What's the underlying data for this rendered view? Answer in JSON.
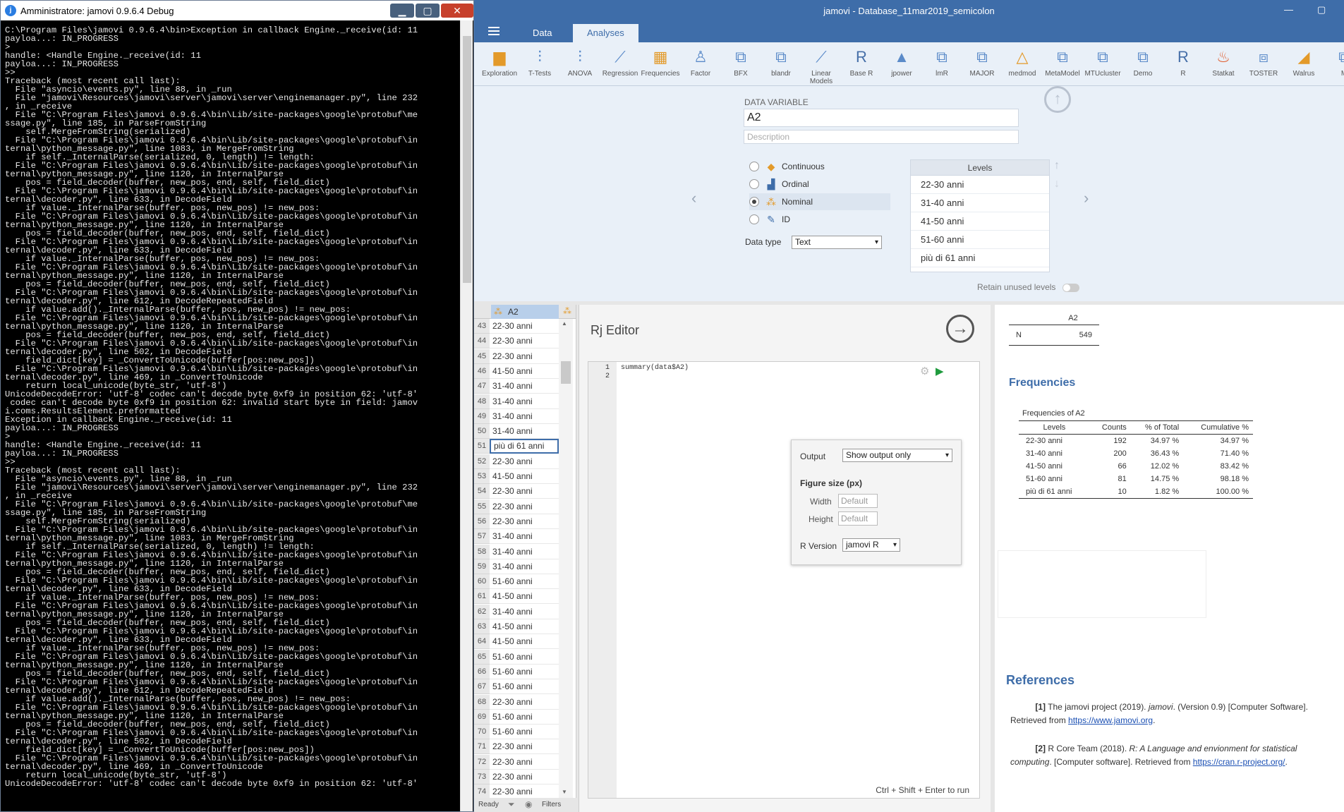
{
  "console": {
    "title": "Amministratore: jamovi 0.9.6.4 Debug",
    "icon": "jamovi-icon",
    "lines": [
      "C:\\Program Files\\jamovi 0.9.6.4\\bin>Exception in callback Engine._receive(id: 11",
      "",
      "payloa...: IN_PROGRESS",
      ">",
      "handle: <Handle Engine._receive(id: 11",
      "payloa...: IN_PROGRESS",
      ">>",
      "Traceback (most recent call last):",
      "  File \"asyncio\\events.py\", line 88, in _run",
      "  File \"jamovi\\Resources\\jamovi\\server\\jamovi\\server\\enginemanager.py\", line 232",
      ", in _receive",
      "  File \"C:\\Program Files\\jamovi 0.9.6.4\\bin\\Lib/site-packages\\google\\protobuf\\me",
      "ssage.py\", line 185, in ParseFromString",
      "    self.MergeFromString(serialized)",
      "  File \"C:\\Program Files\\jamovi 0.9.6.4\\bin\\Lib/site-packages\\google\\protobuf\\in",
      "ternal\\python_message.py\", line 1083, in MergeFromString",
      "    if self._InternalParse(serialized, 0, length) != length:",
      "  File \"C:\\Program Files\\jamovi 0.9.6.4\\bin\\Lib/site-packages\\google\\protobuf\\in",
      "ternal\\python_message.py\", line 1120, in InternalParse",
      "    pos = field_decoder(buffer, new_pos, end, self, field_dict)",
      "  File \"C:\\Program Files\\jamovi 0.9.6.4\\bin\\Lib/site-packages\\google\\protobuf\\in",
      "ternal\\decoder.py\", line 633, in DecodeField",
      "    if value._InternalParse(buffer, pos, new_pos) != new_pos:",
      "  File \"C:\\Program Files\\jamovi 0.9.6.4\\bin\\Lib/site-packages\\google\\protobuf\\in",
      "ternal\\python_message.py\", line 1120, in InternalParse",
      "    pos = field_decoder(buffer, new_pos, end, self, field_dict)",
      "  File \"C:\\Program Files\\jamovi 0.9.6.4\\bin\\Lib/site-packages\\google\\protobuf\\in",
      "ternal\\decoder.py\", line 633, in DecodeField",
      "    if value._InternalParse(buffer, pos, new_pos) != new_pos:",
      "  File \"C:\\Program Files\\jamovi 0.9.6.4\\bin\\Lib/site-packages\\google\\protobuf\\in",
      "ternal\\python_message.py\", line 1120, in InternalParse",
      "    pos = field_decoder(buffer, new_pos, end, self, field_dict)",
      "  File \"C:\\Program Files\\jamovi 0.9.6.4\\bin\\Lib/site-packages\\google\\protobuf\\in",
      "ternal\\decoder.py\", line 612, in DecodeRepeatedField",
      "    if value.add()._InternalParse(buffer, pos, new_pos) != new_pos:",
      "  File \"C:\\Program Files\\jamovi 0.9.6.4\\bin\\Lib/site-packages\\google\\protobuf\\in",
      "ternal\\python_message.py\", line 1120, in InternalParse",
      "    pos = field_decoder(buffer, new_pos, end, self, field_dict)",
      "  File \"C:\\Program Files\\jamovi 0.9.6.4\\bin\\Lib/site-packages\\google\\protobuf\\in",
      "ternal\\decoder.py\", line 502, in DecodeField",
      "    field_dict[key] = _ConvertToUnicode(buffer[pos:new_pos])",
      "  File \"C:\\Program Files\\jamovi 0.9.6.4\\bin\\Lib/site-packages\\google\\protobuf\\in",
      "ternal\\decoder.py\", line 469, in _ConvertToUnicode",
      "    return local_unicode(byte_str, 'utf-8')",
      "UnicodeDecodeError: 'utf-8' codec can't decode byte 0xf9 in position 62: 'utf-8'",
      " codec can't decode byte 0xf9 in position 62: invalid start byte in field: jamov",
      "i.coms.ResultsElement.preformatted",
      "",
      "Exception in callback Engine._receive(id: 11",
      "payloa...: IN_PROGRESS",
      ">",
      "handle: <Handle Engine._receive(id: 11",
      "payloa...: IN_PROGRESS",
      ">>",
      "Traceback (most recent call last):",
      "  File \"asyncio\\events.py\", line 88, in _run",
      "  File \"jamovi\\Resources\\jamovi\\server\\jamovi\\server\\enginemanager.py\", line 232",
      ", in _receive",
      "  File \"C:\\Program Files\\jamovi 0.9.6.4\\bin\\Lib/site-packages\\google\\protobuf\\me",
      "ssage.py\", line 185, in ParseFromString",
      "    self.MergeFromString(serialized)",
      "  File \"C:\\Program Files\\jamovi 0.9.6.4\\bin\\Lib/site-packages\\google\\protobuf\\in",
      "ternal\\python_message.py\", line 1083, in MergeFromString",
      "    if self._InternalParse(serialized, 0, length) != length:",
      "  File \"C:\\Program Files\\jamovi 0.9.6.4\\bin\\Lib/site-packages\\google\\protobuf\\in",
      "ternal\\python_message.py\", line 1120, in InternalParse",
      "    pos = field_decoder(buffer, new_pos, end, self, field_dict)",
      "  File \"C:\\Program Files\\jamovi 0.9.6.4\\bin\\Lib/site-packages\\google\\protobuf\\in",
      "ternal\\decoder.py\", line 633, in DecodeField",
      "    if value._InternalParse(buffer, pos, new_pos) != new_pos:",
      "  File \"C:\\Program Files\\jamovi 0.9.6.4\\bin\\Lib/site-packages\\google\\protobuf\\in",
      "ternal\\python_message.py\", line 1120, in InternalParse",
      "    pos = field_decoder(buffer, new_pos, end, self, field_dict)",
      "  File \"C:\\Program Files\\jamovi 0.9.6.4\\bin\\Lib/site-packages\\google\\protobuf\\in",
      "ternal\\decoder.py\", line 633, in DecodeField",
      "    if value._InternalParse(buffer, pos, new_pos) != new_pos:",
      "  File \"C:\\Program Files\\jamovi 0.9.6.4\\bin\\Lib/site-packages\\google\\protobuf\\in",
      "ternal\\python_message.py\", line 1120, in InternalParse",
      "    pos = field_decoder(buffer, new_pos, end, self, field_dict)",
      "  File \"C:\\Program Files\\jamovi 0.9.6.4\\bin\\Lib/site-packages\\google\\protobuf\\in",
      "ternal\\decoder.py\", line 612, in DecodeRepeatedField",
      "    if value.add()._InternalParse(buffer, pos, new_pos) != new_pos:",
      "  File \"C:\\Program Files\\jamovi 0.9.6.4\\bin\\Lib/site-packages\\google\\protobuf\\in",
      "ternal\\python_message.py\", line 1120, in InternalParse",
      "    pos = field_decoder(buffer, new_pos, end, self, field_dict)",
      "  File \"C:\\Program Files\\jamovi 0.9.6.4\\bin\\Lib/site-packages\\google\\protobuf\\in",
      "ternal\\decoder.py\", line 502, in DecodeField",
      "    field_dict[key] = _ConvertToUnicode(buffer[pos:new_pos])",
      "  File \"C:\\Program Files\\jamovi 0.9.6.4\\bin\\Lib/site-packages\\google\\protobuf\\in",
      "ternal\\decoder.py\", line 469, in _ConvertToUnicode",
      "    return local_unicode(byte_str, 'utf-8')",
      "UnicodeDecodeError: 'utf-8' codec can't decode byte 0xf9 in position 62: 'utf-8'"
    ]
  },
  "app": {
    "title": "jamovi - Database_11mar2019_semicolon",
    "accent": "#3e6da9",
    "tabs": [
      "Data",
      "Analyses"
    ],
    "active_tab": "Analyses"
  },
  "ribbon": [
    {
      "label": "Exploration",
      "icon": "bar-chart-icon",
      "glyph": "▆",
      "color": "#e39a2a"
    },
    {
      "label": "T-Tests",
      "icon": "t-test-icon",
      "glyph": "⫶",
      "color": "#5b8bc9"
    },
    {
      "label": "ANOVA",
      "icon": "anova-icon",
      "glyph": "⫶",
      "color": "#5b8bc9"
    },
    {
      "label": "Regression",
      "icon": "regression-icon",
      "glyph": "⟋",
      "color": "#5b8bc9"
    },
    {
      "label": "Frequencies",
      "icon": "frequencies-icon",
      "glyph": "▦",
      "color": "#e39a2a"
    },
    {
      "label": "Factor",
      "icon": "factor-icon",
      "glyph": "♙",
      "color": "#5b8bc9"
    },
    {
      "label": "BFX",
      "icon": "module-icon",
      "glyph": "⧉",
      "color": "#5b8bc9"
    },
    {
      "label": "blandr",
      "icon": "module-icon",
      "glyph": "⧉",
      "color": "#5b8bc9"
    },
    {
      "label": "Linear Models",
      "icon": "linear-models-icon",
      "glyph": "⟋",
      "color": "#5b8bc9"
    },
    {
      "label": "Base R",
      "icon": "r-logo-icon",
      "glyph": "R",
      "color": "#466fa8"
    },
    {
      "label": "jpower",
      "icon": "jpower-icon",
      "glyph": "▲",
      "color": "#5b8bc9"
    },
    {
      "label": "lmR",
      "icon": "module-icon",
      "glyph": "⧉",
      "color": "#5b8bc9"
    },
    {
      "label": "MAJOR",
      "icon": "module-icon",
      "glyph": "⧉",
      "color": "#5b8bc9"
    },
    {
      "label": "medmod",
      "icon": "medmod-icon",
      "glyph": "△",
      "color": "#e39a2a"
    },
    {
      "label": "MetaModel",
      "icon": "module-icon",
      "glyph": "⧉",
      "color": "#5b8bc9"
    },
    {
      "label": "MTUcluster",
      "icon": "module-icon",
      "glyph": "⧉",
      "color": "#5b8bc9"
    },
    {
      "label": "Demo",
      "icon": "module-icon",
      "glyph": "⧉",
      "color": "#5b8bc9"
    },
    {
      "label": "R",
      "icon": "r-logo-icon",
      "glyph": "R",
      "color": "#466fa8"
    },
    {
      "label": "Statkat",
      "icon": "statkat-icon",
      "glyph": "♨",
      "color": "#e05a2a"
    },
    {
      "label": "TOSTER",
      "icon": "toster-icon",
      "glyph": "⧈",
      "color": "#5b8bc9"
    },
    {
      "label": "Walrus",
      "icon": "walrus-icon",
      "glyph": "◢",
      "color": "#e39a2a"
    },
    {
      "label": "M",
      "icon": "module-icon",
      "glyph": "⧉",
      "color": "#5b8bc9"
    }
  ],
  "variable": {
    "section_label": "DATA VARIABLE",
    "name": "A2",
    "description_placeholder": "Description",
    "measure_types": [
      "Continuous",
      "Ordinal",
      "Nominal",
      "ID"
    ],
    "selected_measure": "Nominal",
    "data_type_label": "Data type",
    "data_type": "Text",
    "levels_header": "Levels",
    "levels": [
      "22-30 anni",
      "31-40 anni",
      "41-50 anni",
      "51-60 anni",
      "più di 61 anni"
    ],
    "retain_unused": "Retain unused levels"
  },
  "sheet": {
    "column": "A2",
    "rows": [
      {
        "n": "43",
        "v": "22-30 anni"
      },
      {
        "n": "44",
        "v": "22-30 anni"
      },
      {
        "n": "45",
        "v": "22-30 anni"
      },
      {
        "n": "46",
        "v": "41-50 anni"
      },
      {
        "n": "47",
        "v": "31-40 anni"
      },
      {
        "n": "48",
        "v": "31-40 anni"
      },
      {
        "n": "49",
        "v": "31-40 anni"
      },
      {
        "n": "50",
        "v": "31-40 anni"
      },
      {
        "n": "51",
        "v": "più di 61 anni"
      },
      {
        "n": "52",
        "v": "22-30 anni"
      },
      {
        "n": "53",
        "v": "41-50 anni"
      },
      {
        "n": "54",
        "v": "22-30 anni"
      },
      {
        "n": "55",
        "v": "22-30 anni"
      },
      {
        "n": "56",
        "v": "22-30 anni"
      },
      {
        "n": "57",
        "v": "31-40 anni"
      },
      {
        "n": "58",
        "v": "31-40 anni"
      },
      {
        "n": "59",
        "v": "31-40 anni"
      },
      {
        "n": "60",
        "v": "51-60 anni"
      },
      {
        "n": "61",
        "v": "41-50 anni"
      },
      {
        "n": "62",
        "v": "31-40 anni"
      },
      {
        "n": "63",
        "v": "41-50 anni"
      },
      {
        "n": "64",
        "v": "41-50 anni"
      },
      {
        "n": "65",
        "v": "51-60 anni"
      },
      {
        "n": "66",
        "v": "51-60 anni"
      },
      {
        "n": "67",
        "v": "51-60 anni"
      },
      {
        "n": "68",
        "v": "22-30 anni"
      },
      {
        "n": "69",
        "v": "51-60 anni"
      },
      {
        "n": "70",
        "v": "51-60 anni"
      },
      {
        "n": "71",
        "v": "22-30 anni"
      },
      {
        "n": "72",
        "v": "22-30 anni"
      },
      {
        "n": "73",
        "v": "22-30 anni"
      },
      {
        "n": "74",
        "v": "22-30 anni"
      }
    ],
    "selected_row": "51",
    "status_ready": "Ready",
    "status_filters": "Filters"
  },
  "rj": {
    "title": "Rj Editor",
    "code_lines": [
      "summary(data$A2)",
      ""
    ],
    "output_label": "Output",
    "output_value": "Show output only",
    "figure_size": "Figure size (px)",
    "width_label": "Width",
    "height_label": "Height",
    "width_placeholder": "Default",
    "height_placeholder": "Default",
    "rversion_label": "R Version",
    "rversion_value": "jamovi R",
    "hint": "Ctrl + Shift + Enter to run"
  },
  "results": {
    "desc_col": "A2",
    "desc_row_label": "N",
    "desc_row_value": "549",
    "freq_title": "Frequencies",
    "freq_table_title": "Frequencies of A2",
    "freq_headers": [
      "Levels",
      "Counts",
      "% of Total",
      "Cumulative %"
    ],
    "freq_rows": [
      [
        "22-30 anni",
        "192",
        "34.97 %",
        "34.97 %"
      ],
      [
        "31-40 anni",
        "200",
        "36.43 %",
        "71.40 %"
      ],
      [
        "41-50 anni",
        "66",
        "12.02 %",
        "83.42 %"
      ],
      [
        "51-60 anni",
        "81",
        "14.75 %",
        "98.18 %"
      ],
      [
        "più di 61 anni",
        "10",
        "1.82 %",
        "100.00 %"
      ]
    ],
    "refs_title": "References",
    "ref1_num": "[1]",
    "ref1_a": "The jamovi project (2019).",
    "ref1_i": "jamovi",
    "ref1_b": ". (Version 0.9) [Computer Software]. Retrieved from",
    "ref1_link": "https://www.jamovi.org",
    "ref2_num": "[2]",
    "ref2_a": "R Core Team (2018).",
    "ref2_i": "R: A Language and envionment for statistical computing",
    "ref2_b": ". [Computer software]. Retrieved from",
    "ref2_link": "https://cran.r-project.org/"
  }
}
